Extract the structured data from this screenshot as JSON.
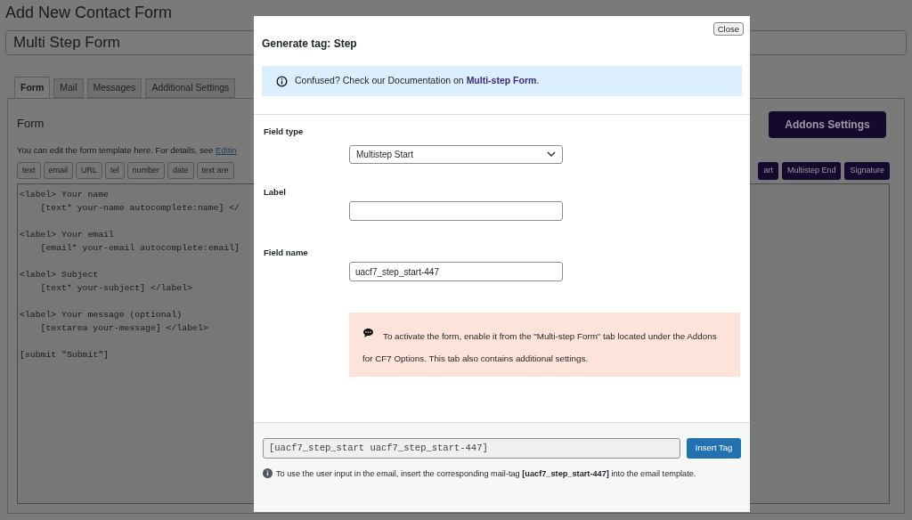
{
  "page": {
    "title": "Add New Contact Form",
    "form_title": "Multi Step Form",
    "tabs": [
      {
        "label": "Form",
        "selected": true
      },
      {
        "label": "Mail",
        "selected": false
      },
      {
        "label": "Messages",
        "selected": false
      },
      {
        "label": "Additional Settings",
        "selected": false
      }
    ],
    "panel": {
      "heading": "Form",
      "help_text": "You can edit the form template here. For details, see ",
      "help_link": "Editin",
      "tag_buttons": [
        "text",
        "email",
        "URL",
        "tel",
        "number",
        "date",
        "text are"
      ],
      "addon_tag_buttons": [
        "art",
        "Multistep End",
        "Signature"
      ],
      "addons_button": "Addons Settings",
      "template": "<label> Your name\n    [text* your-name autocomplete:name] </\n\n<label> Your email\n    [email* your-email autocomplete:email]\n\n<label> Subject\n    [text* your-subject] </label>\n\n<label> Your message (optional)\n    [textarea your-message] </label>\n\n[submit \"Submit\"]"
    }
  },
  "dialog": {
    "title": "Generate tag: Step",
    "close": "Close",
    "info_text": "Confused? Check our Documentation on ",
    "info_link": "Multi-step Form",
    "info_end": ".",
    "fields": [
      {
        "kind": "select",
        "label": "Field type",
        "value": "Multistep Start"
      },
      {
        "kind": "text",
        "label": "Label"
      },
      {
        "kind": "text",
        "label": "Field name",
        "value": "uacf7_step_start-447"
      }
    ],
    "notice": "To activate the form, enable it from the \"Multi-step Form\" tab located under the Addons for CF7 Options. This tab also contains additional settings.",
    "tag_code": "[uacf7_step_start uacf7_step_start-447]",
    "insert_button": "Insert Tag",
    "mail_tag_note": "To use the user input in the email, insert the corresponding mail-tag **[uacf7_step_start-447]** into the email template."
  }
}
